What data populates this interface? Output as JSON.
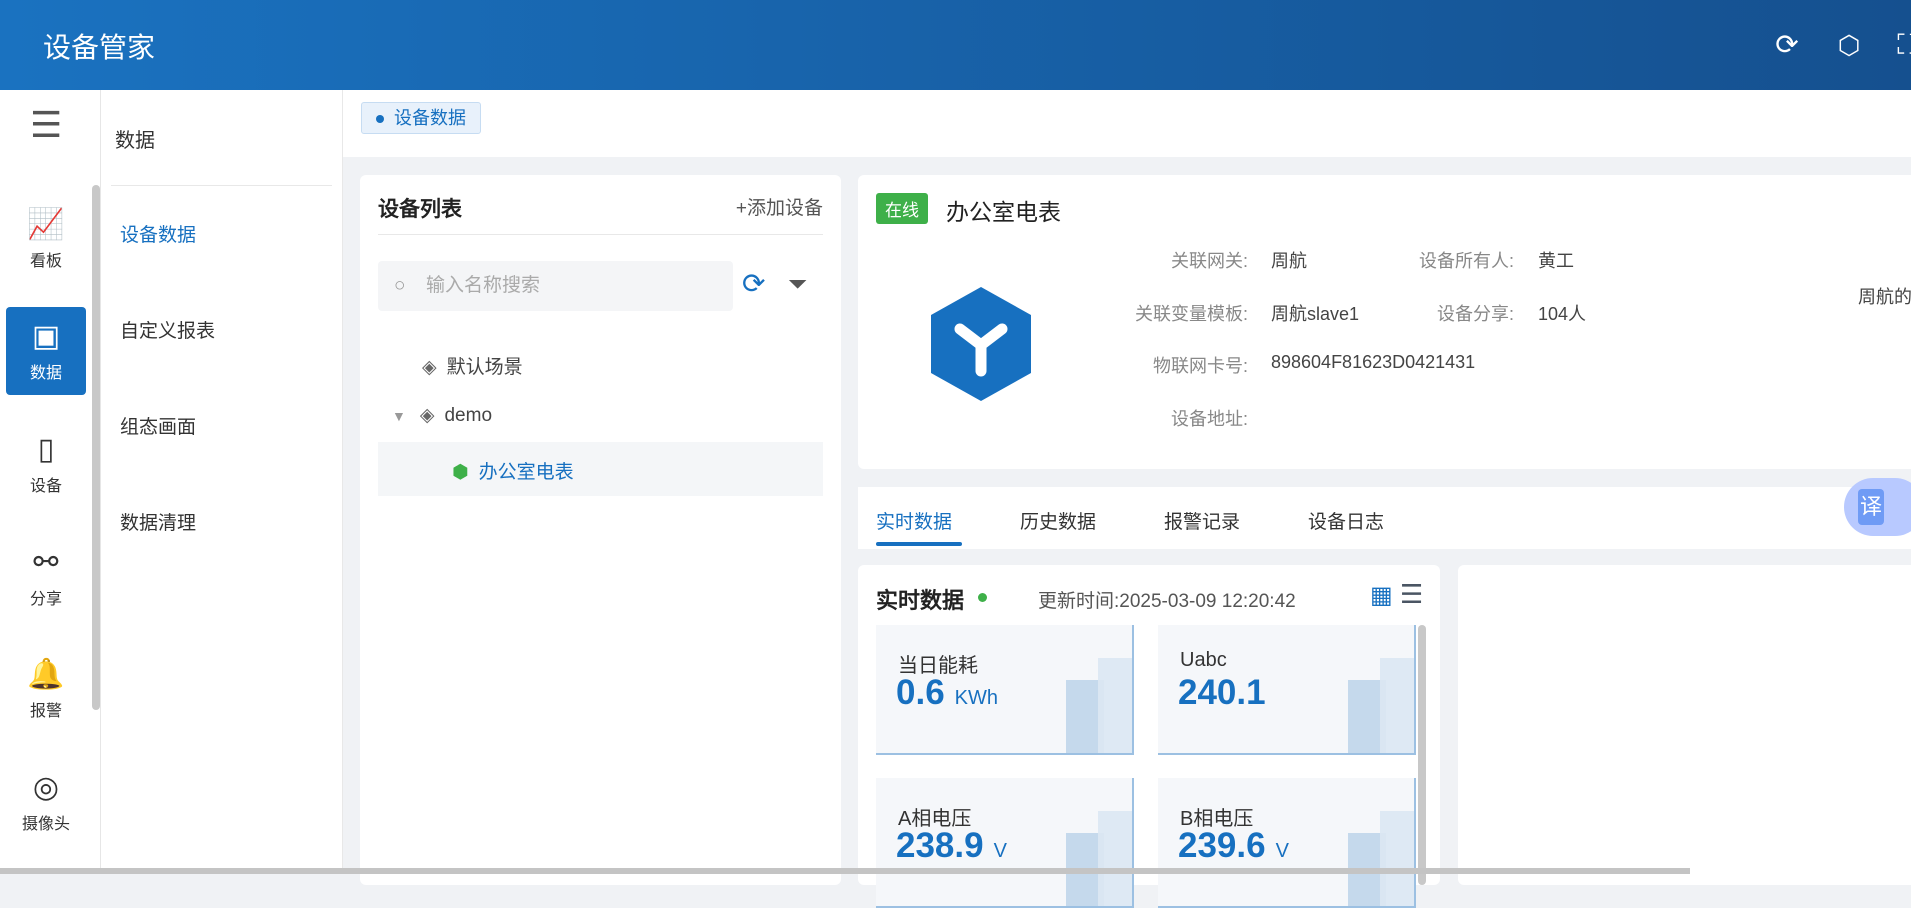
{
  "header": {
    "title": "设备管家",
    "icons": [
      "refresh-icon",
      "settings-icon",
      "fullscreen-icon"
    ]
  },
  "rail": [
    {
      "label": "看板",
      "icon": "dashboard-icon"
    },
    {
      "label": "数据",
      "icon": "chart-icon"
    },
    {
      "label": "设备",
      "icon": "device-icon"
    },
    {
      "label": "分享",
      "icon": "share-icon"
    },
    {
      "label": "报警",
      "icon": "alarm-icon"
    },
    {
      "label": "摄像头",
      "icon": "camera-icon"
    }
  ],
  "sidebar": {
    "title": "数据",
    "items": [
      "设备数据",
      "自定义报表",
      "组态画面",
      "数据清理"
    ]
  },
  "tag": "设备数据",
  "device_list": {
    "title": "设备列表",
    "add": "+添加设备",
    "search_placeholder": "输入名称搜索",
    "tree": [
      "默认场景",
      "demo",
      "办公室电表"
    ]
  },
  "device": {
    "status": "在线",
    "name": "办公室电表",
    "fields": [
      {
        "label": "关联网关:",
        "value": "周航"
      },
      {
        "label": "关联变量模板:",
        "value": "周航slave1"
      },
      {
        "label": "物联网卡号:",
        "value": "898604F81623D0421431"
      },
      {
        "label": "设备地址:",
        "value": ""
      },
      {
        "label": "设备所有人:",
        "value": "黄工"
      },
      {
        "label": "设备分享:",
        "value": "104人"
      }
    ],
    "extra": "周航的"
  },
  "tabs": [
    "实时数据",
    "历史数据",
    "报警记录",
    "设备日志"
  ],
  "realtime": {
    "title": "实时数据",
    "update_label": "更新时间:",
    "update_time": "2025-03-09 12:20:42",
    "tiles": [
      {
        "name": "当日能耗",
        "value": "0.6",
        "unit": "KWh"
      },
      {
        "name": "Uabc",
        "value": "240.1",
        "unit": ""
      },
      {
        "name": "A相电压",
        "value": "238.9",
        "unit": "V"
      },
      {
        "name": "B相电压",
        "value": "239.6",
        "unit": "V"
      }
    ]
  },
  "translate": "译",
  "colors": {
    "primary": "#1770c0",
    "online": "#3eb049"
  }
}
